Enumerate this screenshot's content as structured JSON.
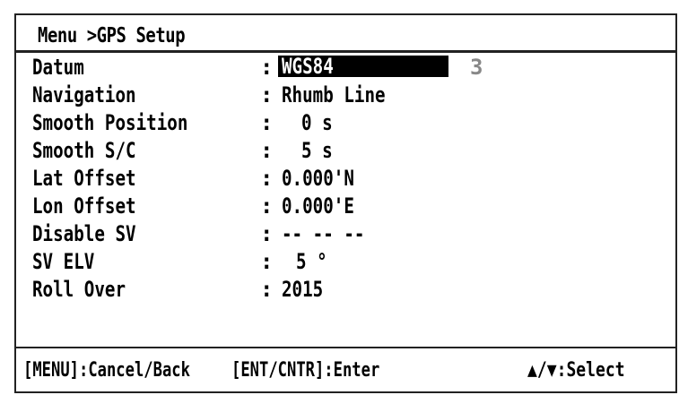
{
  "header": {
    "title": "Menu >GPS Setup"
  },
  "menu": {
    "items": [
      {
        "label": "Datum",
        "colon": ":",
        "value": "WGS84",
        "aux": "3"
      },
      {
        "label": "Navigation",
        "colon": ":",
        "value": "Rhumb Line"
      },
      {
        "label": "Smooth Position",
        "colon": ":",
        "value": "0 s"
      },
      {
        "label": "Smooth S/C",
        "colon": ":",
        "value": "5 s"
      },
      {
        "label": "Lat Offset",
        "colon": ":",
        "value": "0.000'N"
      },
      {
        "label": "Lon Offset",
        "colon": ":",
        "value": "0.000'E"
      },
      {
        "label": "Disable SV",
        "colon": ":",
        "value": "-- -- --"
      },
      {
        "label": "SV ELV",
        "colon": ":",
        "value": "5 °"
      },
      {
        "label": "Roll Over",
        "colon": ":",
        "value": "2015"
      }
    ],
    "selected_index": 0
  },
  "footer": {
    "menu_hint": "[MENU]:Cancel/Back",
    "enter_hint": "[ENT/CNTR]:Enter",
    "select_hint": "▲/▼:Select"
  }
}
